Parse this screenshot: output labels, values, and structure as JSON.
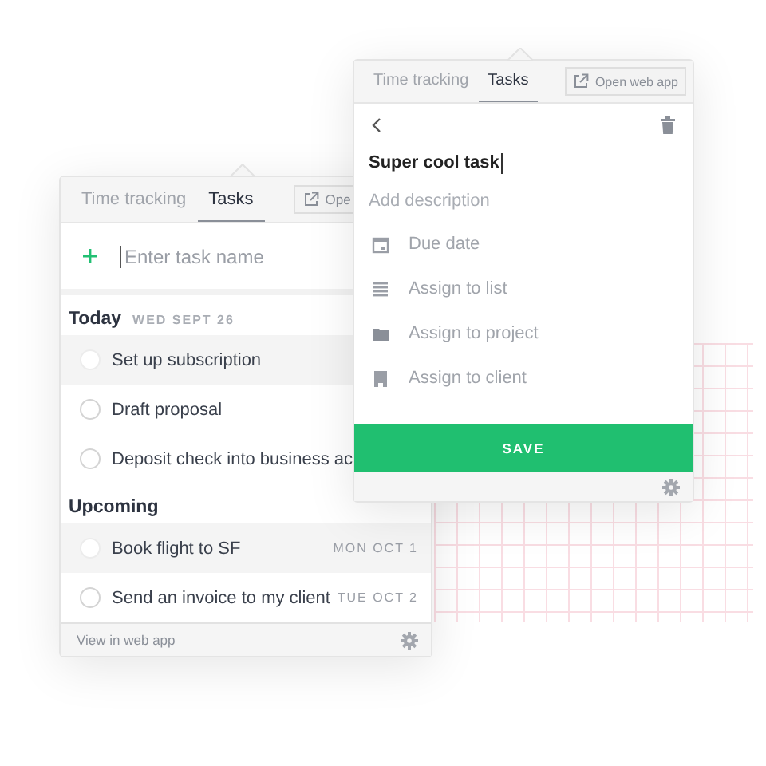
{
  "back_panel": {
    "tabs": [
      {
        "label": "Time tracking",
        "selected": false
      },
      {
        "label": "Tasks",
        "selected": true
      }
    ],
    "open_button": "Ope",
    "new_task": {
      "placeholder": "Enter task name"
    },
    "sections": [
      {
        "title": "Today",
        "date": "WED SEPT 26",
        "tasks": [
          {
            "name": "Set up subscription",
            "highlighted": true
          },
          {
            "name": "Draft proposal",
            "highlighted": false
          },
          {
            "name": "Deposit check into business ac",
            "highlighted": false
          }
        ]
      },
      {
        "title": "Upcoming",
        "tasks": [
          {
            "name": "Book flight to SF",
            "date": "MON OCT 1",
            "highlighted": true
          },
          {
            "name": "Send an invoice to my client",
            "date": "TUE OCT 2",
            "highlighted": false
          }
        ]
      }
    ],
    "footer_link": "View in web app"
  },
  "front_panel": {
    "tabs": [
      {
        "label": "Time tracking",
        "selected": false
      },
      {
        "label": "Tasks",
        "selected": true
      }
    ],
    "open_button": "Open web app",
    "task_name": "Super cool task",
    "description": {
      "placeholder": "Add description"
    },
    "fields": [
      {
        "kind": "date",
        "label": "Due date"
      },
      {
        "kind": "list",
        "label": "Assign to list"
      },
      {
        "kind": "project",
        "label": "Assign to project"
      },
      {
        "kind": "client",
        "label": "Assign to client"
      }
    ],
    "save_button": "SAVE"
  }
}
